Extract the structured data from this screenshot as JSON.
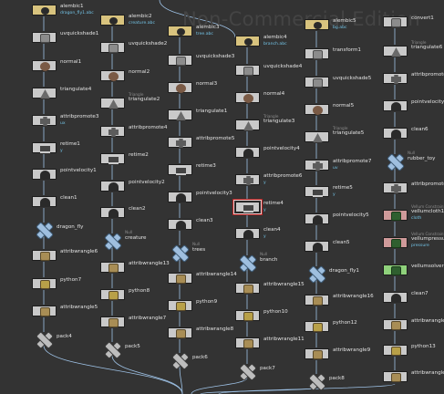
{
  "watermark": "Non-Commercial Edition",
  "colors": {
    "background": "#333333",
    "wire": "#9ec2e6",
    "node_default": "#c9c9c9",
    "node_file": "#d8c37e",
    "node_dynamic": "#cf9a9a",
    "node_vellum": "#8fd17b",
    "label": "#e4e4e4",
    "sublabel": "#73c3e6",
    "selection": "#f0c8c8"
  },
  "columns": [
    {
      "id": "col1",
      "nodes": [
        {
          "label": "alembic1",
          "sub": "dragon_fly1.abc",
          "kind": "file",
          "icon": "file-icon"
        },
        {
          "label": "uvquickshade1",
          "icon": "shade-icon"
        },
        {
          "label": "normal1",
          "icon": "normal-icon"
        },
        {
          "label": "triangulate4",
          "icon": "triangle-icon"
        },
        {
          "label": "attribpromote3",
          "sub": "ux",
          "icon": "promote-icon"
        },
        {
          "label": "retime1",
          "sub": "y",
          "icon": "retime-icon"
        },
        {
          "label": "pointvelocity1",
          "icon": "velocity-icon"
        },
        {
          "label": "clean1",
          "icon": "clean-icon"
        },
        {
          "label": "dragon_fly",
          "type": "",
          "kind": "xblue",
          "icon": "merge-icon"
        },
        {
          "label": "attribwrangle6",
          "icon": "wrangle-icon"
        },
        {
          "label": "python7",
          "icon": "python-icon"
        },
        {
          "label": "attribwrangle5",
          "icon": "wrangle-icon"
        },
        {
          "label": "pack4",
          "kind": "xgray",
          "icon": "pack-icon"
        }
      ]
    },
    {
      "id": "col2",
      "nodes": [
        {
          "label": "alembic2",
          "sub": "creature.abc",
          "kind": "file",
          "icon": "file-icon"
        },
        {
          "label": "uvquickshade2",
          "icon": "shade-icon"
        },
        {
          "label": "normal2",
          "icon": "normal-icon"
        },
        {
          "label": "triangulate2",
          "type": "Triangle",
          "icon": "triangle-icon"
        },
        {
          "label": "attribpromote4",
          "icon": "promote-icon"
        },
        {
          "label": "retime2",
          "icon": "retime-icon"
        },
        {
          "label": "pointvelocity2",
          "icon": "velocity-icon"
        },
        {
          "label": "clean2",
          "icon": "clean-icon"
        },
        {
          "label": "creature",
          "type": "Null",
          "kind": "xblue",
          "icon": "merge-icon"
        },
        {
          "label": "attribwrangle13",
          "icon": "wrangle-icon"
        },
        {
          "label": "python8",
          "icon": "python-icon"
        },
        {
          "label": "attribwrangle7",
          "icon": "wrangle-icon"
        },
        {
          "label": "pack5",
          "kind": "xgray",
          "icon": "pack-icon"
        }
      ]
    },
    {
      "id": "col3",
      "nodes": [
        {
          "label": "alembic3",
          "sub": "tree.abc",
          "kind": "file",
          "icon": "file-icon"
        },
        {
          "label": "uvquickshade3",
          "icon": "shade-icon"
        },
        {
          "label": "normal3",
          "icon": "normal-icon"
        },
        {
          "label": "triangulate1",
          "icon": "triangle-icon"
        },
        {
          "label": "attribpromote5",
          "icon": "promote-icon"
        },
        {
          "label": "retime3",
          "icon": "retime-icon"
        },
        {
          "label": "pointvelocity3",
          "icon": "velocity-icon"
        },
        {
          "label": "clean3",
          "icon": "clean-icon"
        },
        {
          "label": "trees",
          "type": "Null",
          "kind": "xblue",
          "icon": "merge-icon"
        },
        {
          "label": "attribwrangle14",
          "icon": "wrangle-icon"
        },
        {
          "label": "python9",
          "icon": "python-icon"
        },
        {
          "label": "attribwrangle8",
          "icon": "wrangle-icon"
        },
        {
          "label": "pack6",
          "kind": "xgray",
          "icon": "pack-icon"
        }
      ]
    },
    {
      "id": "col4",
      "nodes": [
        {
          "label": "alembic4",
          "sub": "branch.abc",
          "kind": "file",
          "icon": "file-icon"
        },
        {
          "label": "uvquickshade4",
          "icon": "shade-icon"
        },
        {
          "label": "normal4",
          "icon": "normal-icon"
        },
        {
          "label": "triangulate3",
          "type": "Triangle",
          "icon": "triangle-icon"
        },
        {
          "label": "pointvelocity4",
          "icon": "velocity-icon"
        },
        {
          "label": "attribpromote6",
          "sub": "y",
          "icon": "promote-icon"
        },
        {
          "label": "retime4",
          "sub": "y",
          "kind": "selected",
          "icon": "retime-icon"
        },
        {
          "label": "clean4",
          "sub": "y",
          "icon": "clean-icon"
        },
        {
          "label": "branch",
          "type": "Null",
          "kind": "xblue",
          "icon": "merge-icon"
        },
        {
          "label": "attribwrangle15",
          "icon": "wrangle-icon"
        },
        {
          "label": "python10",
          "icon": "python-icon"
        },
        {
          "label": "attribwrangle11",
          "icon": "wrangle-icon"
        },
        {
          "label": "pack7",
          "kind": "xgray",
          "icon": "pack-icon"
        }
      ]
    },
    {
      "id": "col5",
      "nodes": [
        {
          "label": "alembic5",
          "sub": "bg.abc",
          "kind": "file",
          "icon": "file-icon"
        },
        {
          "label": "transform1",
          "icon": "transform-icon"
        },
        {
          "label": "uvquickshade5",
          "icon": "shade-icon"
        },
        {
          "label": "normal5",
          "icon": "normal-icon"
        },
        {
          "label": "triangulate5",
          "type": "Triangle",
          "icon": "triangle-icon"
        },
        {
          "label": "attribpromote7",
          "sub": "uv",
          "icon": "promote-icon"
        },
        {
          "label": "retime5",
          "sub": "y",
          "icon": "retime-icon"
        },
        {
          "label": "pointvelocity5",
          "icon": "velocity-icon"
        },
        {
          "label": "clean5",
          "icon": "clean-icon"
        },
        {
          "label": "dragon_fly1",
          "kind": "xblue",
          "icon": "merge-icon"
        },
        {
          "label": "attribwrangle16",
          "icon": "wrangle-icon"
        },
        {
          "label": "python12",
          "icon": "python-icon"
        },
        {
          "label": "attribwrangle9",
          "icon": "wrangle-icon"
        },
        {
          "label": "pack8",
          "kind": "xgray",
          "icon": "pack-icon"
        }
      ]
    },
    {
      "id": "col6",
      "nodes": [
        {
          "label": "convert1",
          "icon": "convert-icon"
        },
        {
          "label": "triangulate6",
          "type": "Triangle",
          "kind": "bypass",
          "icon": "triangle-icon"
        },
        {
          "label": "attribpromote8",
          "icon": "promote-icon"
        },
        {
          "label": "pointvelocity6",
          "icon": "velocity-icon"
        },
        {
          "label": "clean6",
          "icon": "clean-icon"
        },
        {
          "label": "rubber_toy",
          "type": "Null",
          "kind": "xblue",
          "icon": "merge-icon"
        },
        {
          "label": "attribpromote9",
          "kind": "bypass",
          "icon": "promote-icon"
        },
        {
          "label": "vellumcloth1",
          "type": "Vellum Constraints",
          "sub": "cloth",
          "kind": "dyn",
          "icon": "vellum-icon"
        },
        {
          "label": "vellumpressure1",
          "type": "Vellum Constraints",
          "sub": "pressure",
          "kind": "dyn",
          "icon": "vellum-icon"
        },
        {
          "label": "vellumsolver1",
          "kind": "vel",
          "icon": "solver-icon"
        },
        {
          "label": "clean7",
          "icon": "clean-icon"
        },
        {
          "label": "attribwrangle10",
          "icon": "wrangle-icon"
        },
        {
          "label": "python13",
          "icon": "python-icon"
        },
        {
          "label": "attribwrangle17",
          "icon": "wrangle-icon"
        }
      ]
    }
  ]
}
